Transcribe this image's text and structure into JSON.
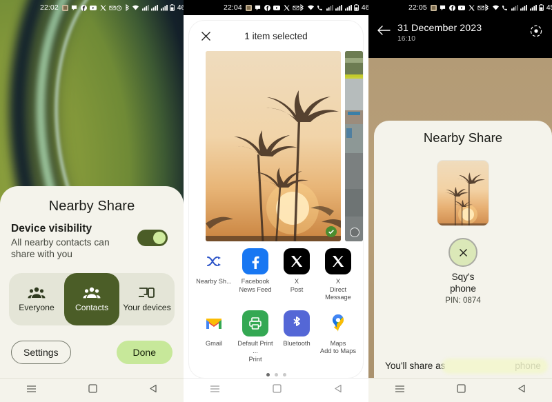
{
  "panels": {
    "left": {
      "status": {
        "clock": "22:02",
        "battery": "46%"
      },
      "sheet": {
        "title": "Nearby Share",
        "visibility_heading": "Device visibility",
        "visibility_sub": "All nearby contacts can share with you",
        "toggle_state": "on",
        "options": [
          {
            "label": "Everyone",
            "icon": "people-icon",
            "active": false
          },
          {
            "label": "Contacts",
            "icon": "people-icon",
            "active": true
          },
          {
            "label": "Your devices",
            "icon": "devices-icon",
            "active": false
          }
        ],
        "settings_label": "Settings",
        "done_label": "Done"
      }
    },
    "mid": {
      "status": {
        "clock": "22:04",
        "battery": "46%"
      },
      "share": {
        "close_icon": "close-icon",
        "title": "1 item selected",
        "apps_row1": [
          {
            "name": "Nearby Sh...",
            "sub": "",
            "icon": "nearby-share-icon",
            "pinned": true
          },
          {
            "name": "Facebook",
            "sub": "News Feed",
            "icon": "facebook-icon",
            "pinned": false
          },
          {
            "name": "X",
            "sub": "Post",
            "icon": "x-icon",
            "pinned": false
          },
          {
            "name": "X",
            "sub": "Direct Message",
            "icon": "x-icon",
            "pinned": false
          }
        ],
        "apps_row2": [
          {
            "name": "Gmail",
            "sub": "",
            "icon": "gmail-icon",
            "pinned": false
          },
          {
            "name": "Default Print ...",
            "sub": "Print",
            "icon": "printer-icon",
            "pinned": false
          },
          {
            "name": "Bluetooth",
            "sub": "",
            "icon": "bluetooth-icon",
            "pinned": false
          },
          {
            "name": "Maps",
            "sub": "Add to Maps",
            "icon": "maps-icon",
            "pinned": false
          }
        ],
        "page_dots": 3,
        "page_active": 1
      }
    },
    "right": {
      "status": {
        "clock": "22:05",
        "battery": "45%"
      },
      "photo": {
        "back_icon": "back-arrow-icon",
        "date": "31 December 2023",
        "time": "16:10",
        "lens_icon": "lens-icon"
      },
      "sheet": {
        "title": "Nearby Share",
        "device_name": "Sqy's phone",
        "device_pin": "PIN: 0874",
        "device_icon": "close-icon",
        "share_as_label": "You'll share as",
        "share_as_value": "phone"
      }
    }
  },
  "navbar": {
    "menu_icon": "menu-icon",
    "home_icon": "home-icon",
    "back_icon": "back-icon"
  },
  "colors": {
    "sheet_bg": "#f4f3eb",
    "accent_green": "#4b5d27",
    "button_green": "#c7e89a",
    "toggle_knob": "#cfeb9e"
  }
}
